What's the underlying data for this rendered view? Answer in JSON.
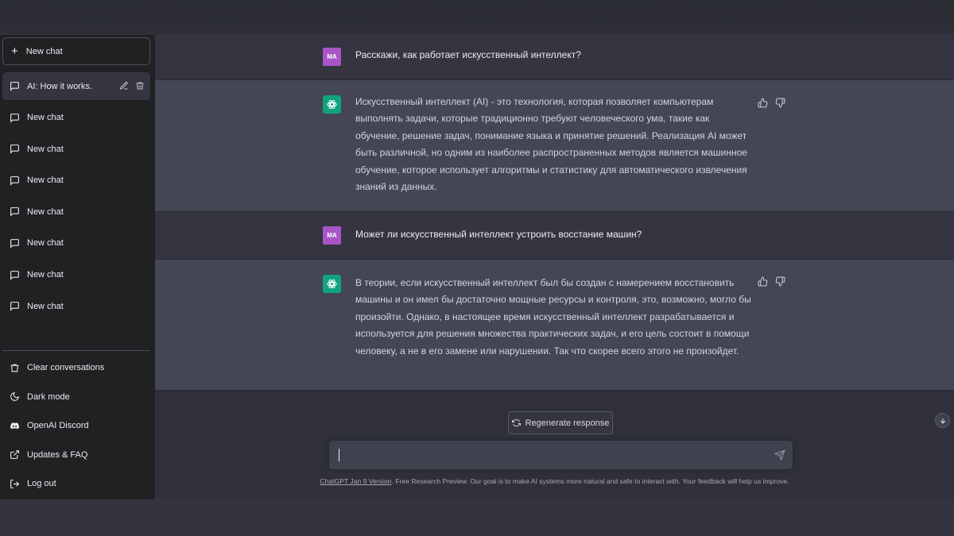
{
  "sidebar": {
    "new_chat_label": "New chat",
    "conversations": [
      {
        "title": "AI: How it works.",
        "active": true
      },
      {
        "title": "New chat"
      },
      {
        "title": "New chat"
      },
      {
        "title": "New chat"
      },
      {
        "title": "New chat"
      },
      {
        "title": "New chat"
      },
      {
        "title": "New chat"
      },
      {
        "title": "New chat"
      }
    ],
    "menu": [
      {
        "label": "Clear conversations",
        "icon": "trash-icon"
      },
      {
        "label": "Dark mode",
        "icon": "moon-icon"
      },
      {
        "label": "OpenAI Discord",
        "icon": "discord-icon"
      },
      {
        "label": "Updates & FAQ",
        "icon": "external-link-icon"
      },
      {
        "label": "Log out",
        "icon": "logout-icon"
      }
    ]
  },
  "chat": {
    "user_initials": "MA",
    "messages": [
      {
        "role": "user",
        "text": "Расскажи, как работает искусственный интеллект?"
      },
      {
        "role": "assistant",
        "text": "Искусственный интеллект (AI) - это технология, которая позволяет компьютерам выполнять задачи, которые традиционно требуют человеческого ума, такие как обучение, решение задач, понимание языка и принятие решений. Реализация AI может быть различной, но одним из наиболее распространенных методов является машинное обучение, которое использует алгоритмы и статистику для автоматического извлечения знаний из данных."
      },
      {
        "role": "user",
        "text": "Может ли искусственный интеллект устроить восстание машин?"
      },
      {
        "role": "assistant",
        "text": "В теории, если искусственный интеллект был бы создан с намерением восстановить машины и он имел бы достаточно мощные ресурсы и контроля, это, возможно, могло бы произойти. Однако, в настоящее время искусственный интеллект разрабатывается и используется для решения множества практических задач, и его цель состоит в помощи человеку, а не в его замене или нарушении. Так что скорее всего этого не произойдет."
      }
    ],
    "regenerate_label": "Regenerate response",
    "input_value": "",
    "footer_link": "ChatGPT Jan 9 Version",
    "footer_text": ". Free Research Preview. Our goal is to make AI systems more natural and safe to interact with. Your feedback will help us improve."
  },
  "colors": {
    "sidebar_bg": "#202123",
    "user_row_bg": "#343541",
    "assistant_row_bg": "#444654",
    "accent_green": "#10a37f",
    "user_avatar": "#a855c7"
  }
}
